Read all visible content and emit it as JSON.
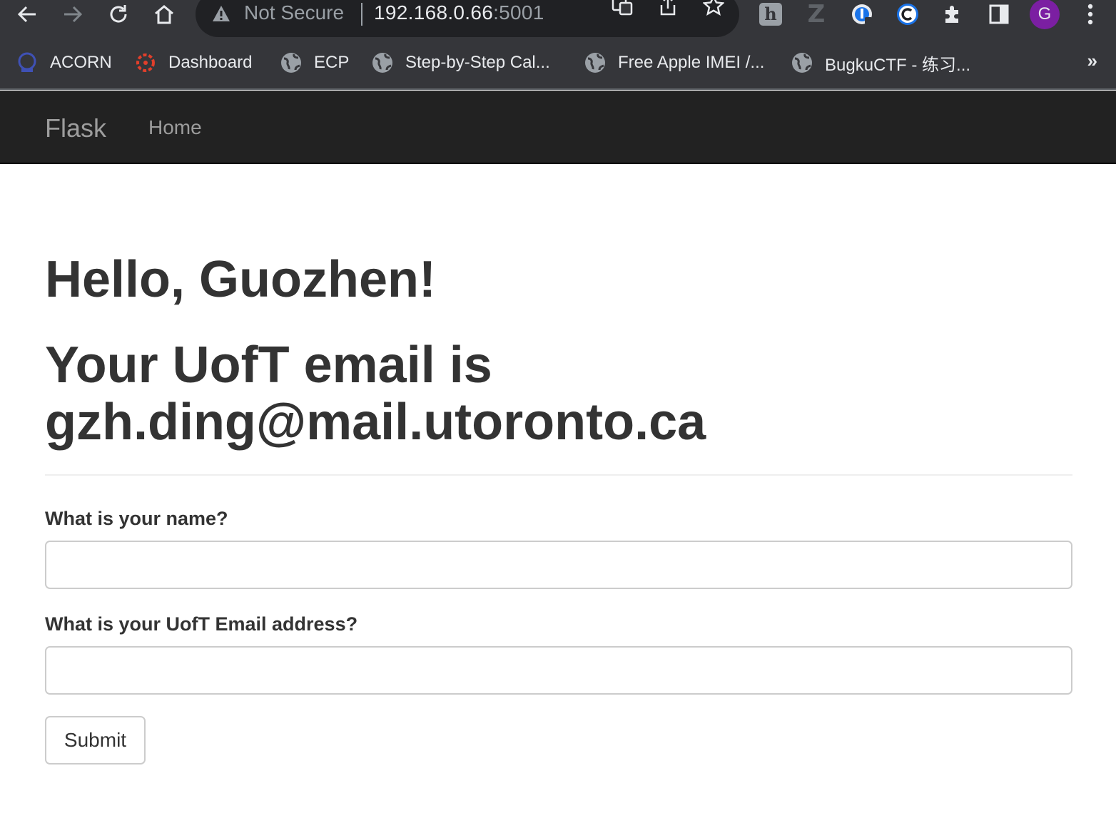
{
  "browser": {
    "security_label": "Not Secure",
    "url_host": "192.168.0.66",
    "url_port": ":5001",
    "profile_initial": "G"
  },
  "bookmarks": [
    {
      "label": "ACORN",
      "icon": "acorn-icon"
    },
    {
      "label": "Dashboard",
      "icon": "dashboard-icon"
    },
    {
      "label": "ECP",
      "icon": "globe-icon"
    },
    {
      "label": "Step-by-Step Cal...",
      "icon": "globe-icon"
    },
    {
      "label": "Free Apple IMEI /...",
      "icon": "globe-icon"
    },
    {
      "label": "BugkuCTF - 练习...",
      "icon": "globe-icon"
    }
  ],
  "bookmarks_more": "»",
  "navbar": {
    "brand": "Flask",
    "links": [
      "Home"
    ]
  },
  "main": {
    "greeting": "Hello, Guozhen!",
    "email_line": "Your UofT email is gzh.ding@mail.utoronto.ca",
    "form": {
      "name_label": "What is your name?",
      "name_value": "",
      "email_label": "What is your UofT Email address?",
      "email_value": "",
      "submit_label": "Submit"
    }
  },
  "colors": {
    "toolbar_bg": "#35363a",
    "navbar_bg": "#222222",
    "heading_text": "#333333",
    "profile_avatar": "#7b1fa2"
  }
}
